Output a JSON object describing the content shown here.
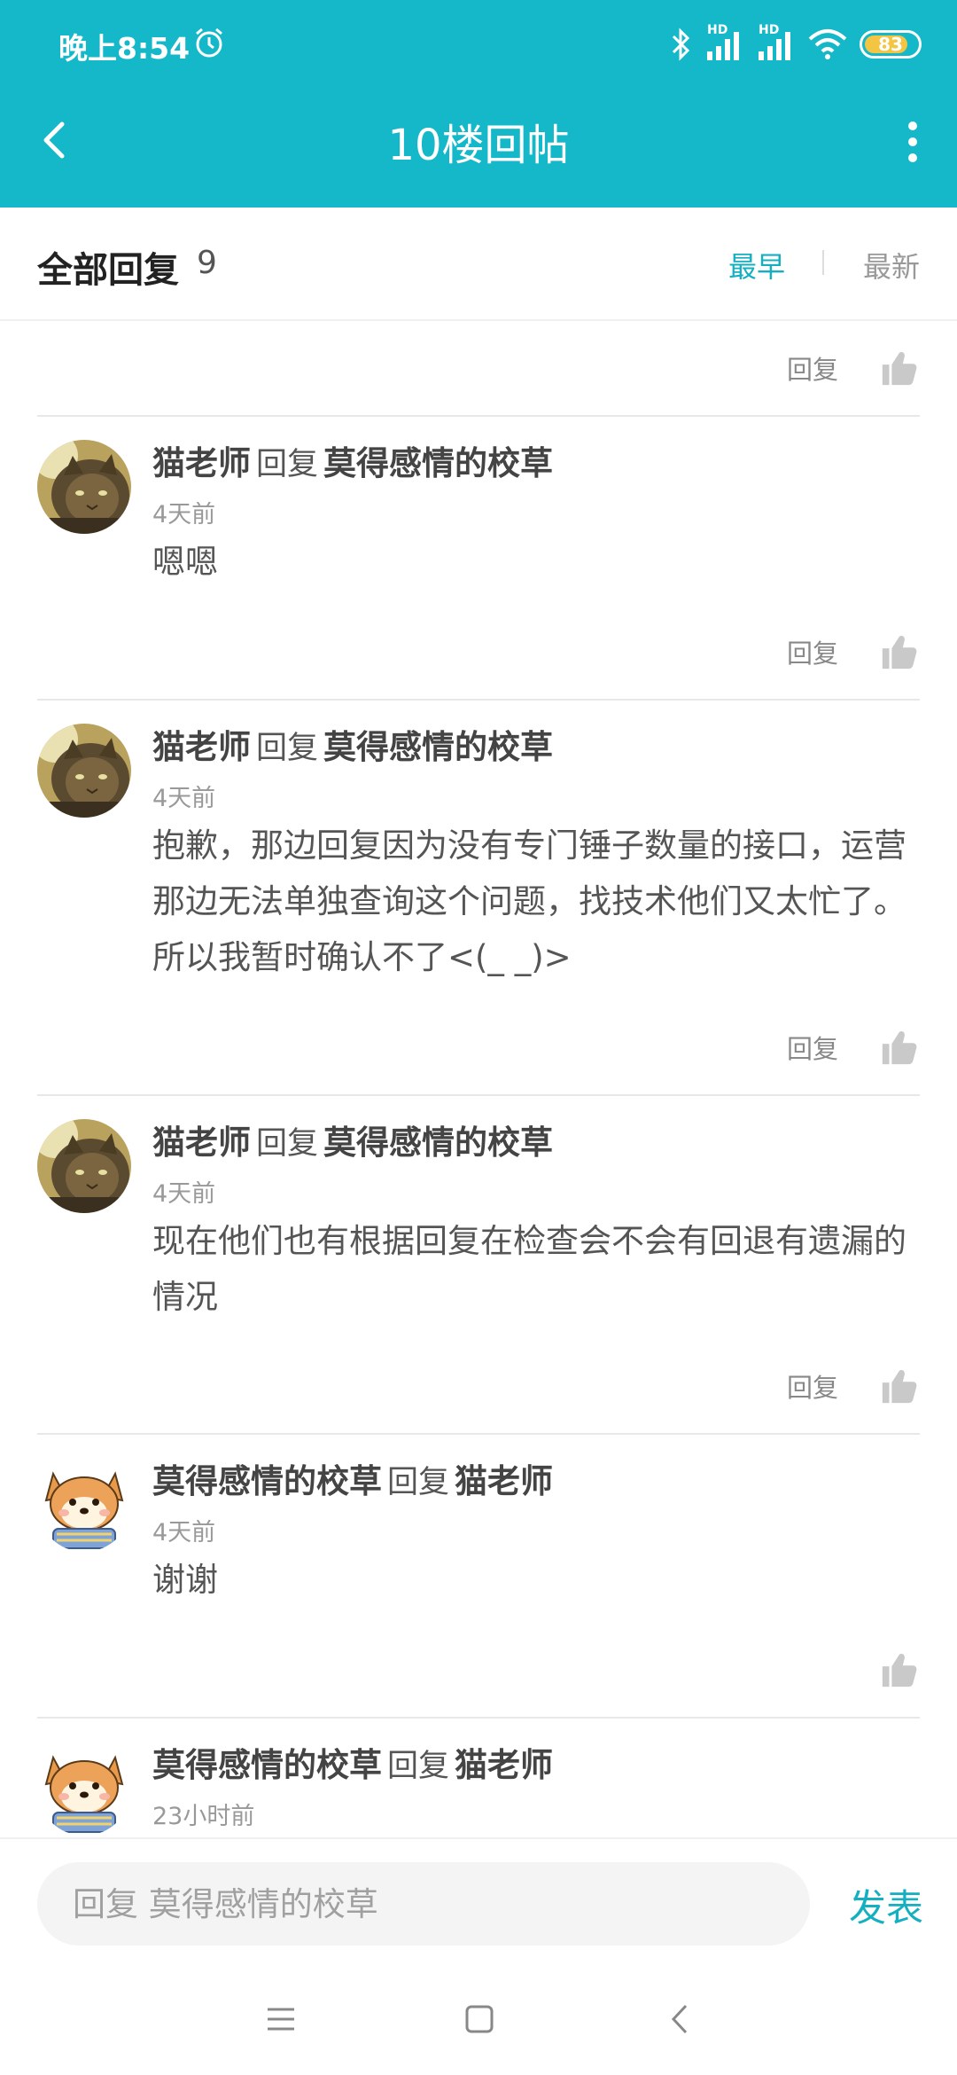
{
  "status_bar": {
    "time": "晚上8:54",
    "battery": "83",
    "network_labels": [
      "HD",
      "HD"
    ]
  },
  "header": {
    "title": "10楼回帖",
    "background_color": "#14b8c8"
  },
  "filter": {
    "all_replies_label": "全部回复",
    "count": "9",
    "sort_earliest": "最早",
    "sort_latest": "最新",
    "active_color": "#14b0c2"
  },
  "top_partial": {
    "reply_label": "回复"
  },
  "comments": [
    {
      "author": "猫老师",
      "reply_word": "回复",
      "target": "莫得感情的校草",
      "time": "4天前",
      "text": "嗯嗯",
      "reply_label": "回复",
      "avatar": "cat-avatar"
    },
    {
      "author": "猫老师",
      "reply_word": "回复",
      "target": "莫得感情的校草",
      "time": "4天前",
      "text": "抱歉，那边回复因为没有专门锤子数量的接口，运营那边无法单独查询这个问题，找技术他们又太忙了。所以我暂时确认不了<(_ _)>",
      "reply_label": "回复",
      "avatar": "cat-avatar"
    },
    {
      "author": "猫老师",
      "reply_word": "回复",
      "target": "莫得感情的校草",
      "time": "4天前",
      "text": "现在他们也有根据回复在检查会不会有回退有遗漏的情况",
      "reply_label": "回复",
      "avatar": "cat-avatar"
    },
    {
      "author": "莫得感情的校草",
      "reply_word": "回复",
      "target": "猫老师",
      "time": "4天前",
      "text": "谢谢",
      "avatar": "shiba-avatar"
    },
    {
      "author": "莫得感情的校草",
      "reply_word": "回复",
      "target": "猫老师",
      "time": "23小时前",
      "text": "",
      "avatar": "shiba-avatar"
    }
  ],
  "input": {
    "placeholder": "回复 莫得感情的校草",
    "submit_label": "发表"
  },
  "icons": {
    "back": "back-arrow-icon",
    "more": "more-vertical-icon",
    "like": "thumbs-up-icon",
    "alarm": "alarm-clock-icon",
    "bluetooth": "bluetooth-icon",
    "wifi": "wifi-icon",
    "nav_menu": "menu-icon",
    "nav_home": "home-square-icon",
    "nav_back": "nav-back-icon"
  }
}
